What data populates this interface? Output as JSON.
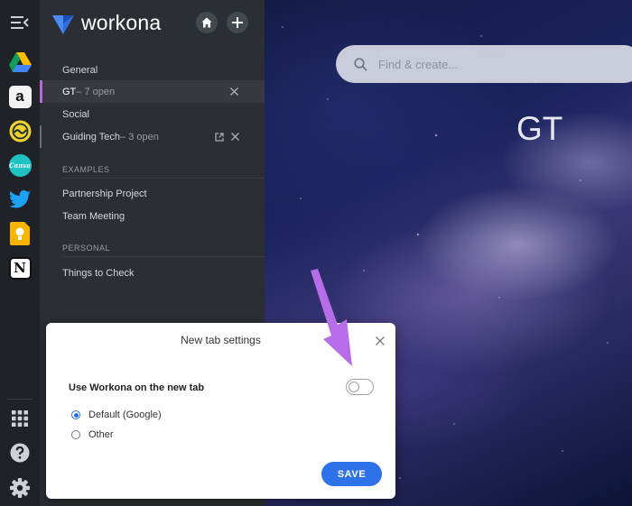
{
  "brand": {
    "name": "workona"
  },
  "rail": {
    "apps": [
      {
        "name": "Google Drive",
        "icon": "google-drive-icon"
      },
      {
        "name": "Amazon",
        "icon": "amazon-icon",
        "glyph": "a"
      },
      {
        "name": "Basecamp",
        "icon": "basecamp-icon"
      },
      {
        "name": "Canva",
        "icon": "canva-icon",
        "glyph": "Canva"
      },
      {
        "name": "Twitter",
        "icon": "twitter-icon"
      },
      {
        "name": "Google Keep",
        "icon": "keep-icon"
      },
      {
        "name": "Notion",
        "icon": "notion-icon",
        "glyph": "N"
      }
    ]
  },
  "sidebar": {
    "workspaces": [
      {
        "label": "General",
        "sub": ""
      },
      {
        "label": "GT",
        "sub": " – 7 open",
        "active": true
      },
      {
        "label": "Social",
        "sub": ""
      },
      {
        "label": "Guiding Tech",
        "sub": " – 3 open"
      }
    ],
    "sections": [
      {
        "heading": "EXAMPLES",
        "items": [
          "Partnership Project",
          "Team Meeting"
        ]
      },
      {
        "heading": "PERSONAL",
        "items": [
          "Things to Check"
        ]
      }
    ]
  },
  "search": {
    "placeholder": "Find & create..."
  },
  "main": {
    "title": "GT"
  },
  "modal": {
    "title": "New tab settings",
    "option_label": "Use Workona on the new tab",
    "toggle_on": false,
    "radios": [
      {
        "label": "Default (Google)",
        "checked": true
      },
      {
        "label": "Other",
        "checked": false
      }
    ],
    "save_label": "SAVE"
  },
  "colors": {
    "accent": "#2e72ea",
    "active_marker": "#b16bd6",
    "annotation_arrow": "#b76de8"
  }
}
